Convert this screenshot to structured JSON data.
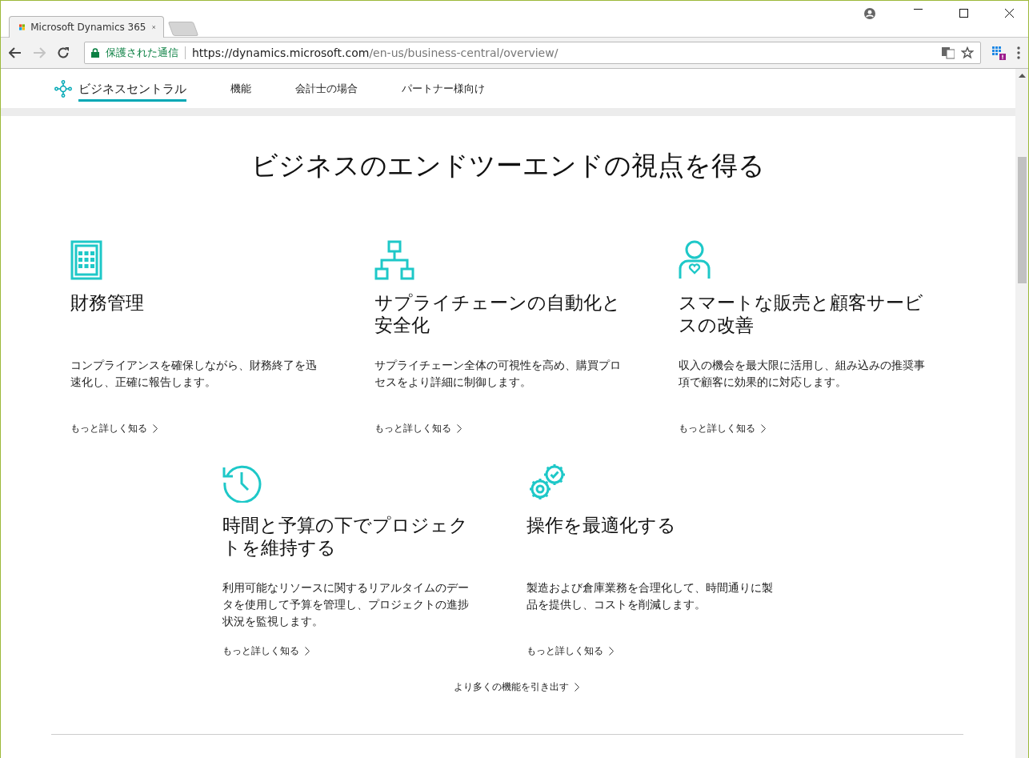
{
  "browser": {
    "tab_title": "Microsoft Dynamics 365",
    "security_label": "保護された通信",
    "url_host": "https://dynamics.microsoft.com",
    "url_path": "/en-us/business-central/overview/"
  },
  "nav": {
    "items": [
      {
        "label": "ビジネスセントラル",
        "selected": true,
        "kind": "brand"
      },
      {
        "label": "機能",
        "selected": false,
        "kind": "link"
      },
      {
        "label": "会計士の場合",
        "selected": false,
        "kind": "link"
      },
      {
        "label": "パートナー様向け",
        "selected": false,
        "kind": "link"
      }
    ]
  },
  "heading": "ビジネスのエンドツーエンドの視点を得る",
  "features": [
    {
      "kind": "calculator",
      "title": "財務管理",
      "description": "コンプライアンスを確保しながら、財務終了を迅速化し、正確に報告します。",
      "link": "もっと詳しく知る"
    },
    {
      "kind": "hierarchy",
      "title": "サプライチェーンの自動化と安全化",
      "description": "サプライチェーン全体の可視性を高め、購買プロセスをより詳細に制御します。",
      "link": "もっと詳しく知る"
    },
    {
      "kind": "person",
      "title": "スマートな販売と顧客サービスの改善",
      "description": "収入の機会を最大限に活用し、組み込みの推奨事項で顧客に効果的に対応します。",
      "link": "もっと詳しく知る"
    },
    {
      "kind": "clock",
      "title": "時間と予算の下でプロジェクトを維持する",
      "description": "利用可能なリソースに関するリアルタイムのデータを使用して予算を管理し、プロジェクトの進捗状況を監視します。",
      "link": "もっと詳しく知る"
    },
    {
      "kind": "gears",
      "title": "操作を最適化する",
      "description": "製造および倉庫業務を合理化して、時間通りに製品を提供し、コストを削減します。",
      "link": "もっと詳しく知る"
    }
  ],
  "more_link": "より多くの機能を引き出す"
}
